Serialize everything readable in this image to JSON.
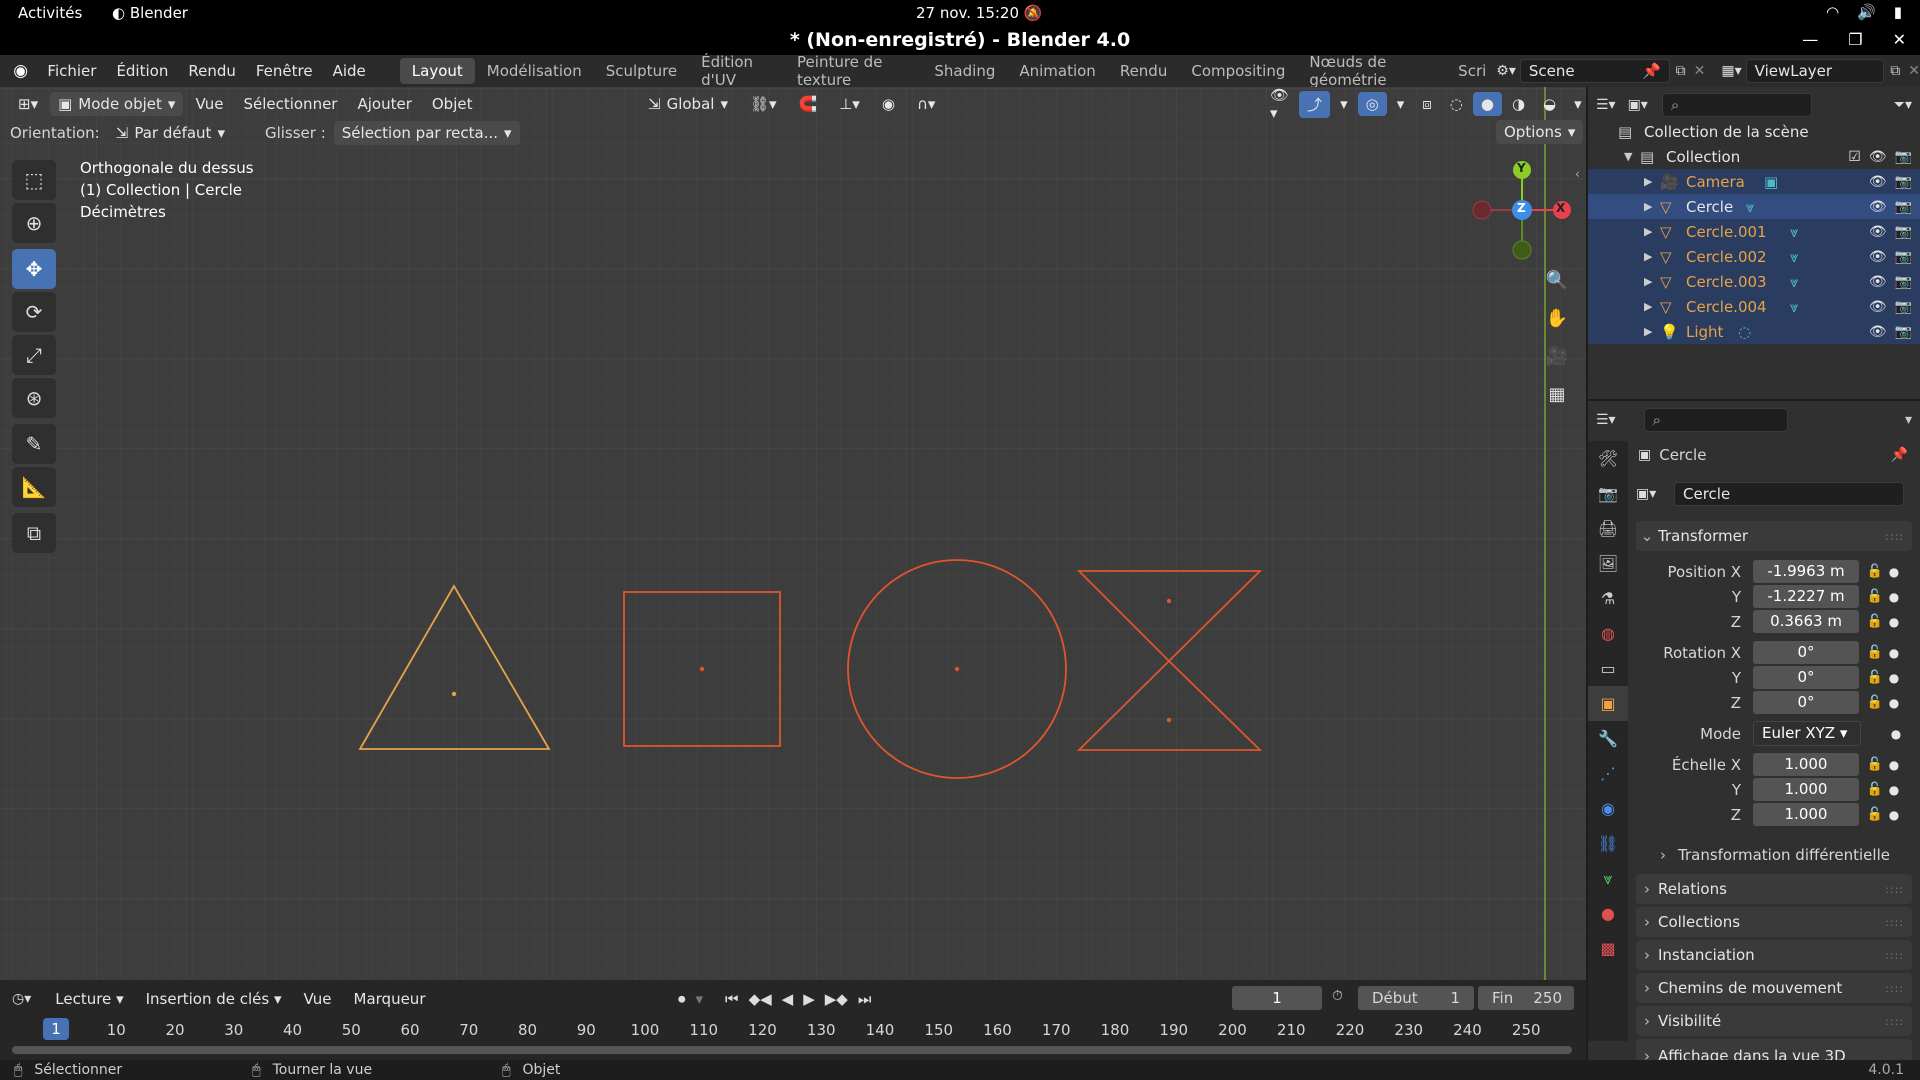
{
  "system": {
    "activities": "Activités",
    "app_name": "Blender",
    "clock": "27 nov.  15:20"
  },
  "window": {
    "title": "* (Non-enregistré) - Blender 4.0"
  },
  "menu": [
    "Fichier",
    "Édition",
    "Rendu",
    "Fenêtre",
    "Aide"
  ],
  "workspaces": [
    "Layout",
    "Modélisation",
    "Sculpture",
    "Édition d'UV",
    "Peinture de texture",
    "Shading",
    "Animation",
    "Rendu",
    "Compositing",
    "Nœuds de géométrie",
    "Scri"
  ],
  "scene": {
    "name": "Scene",
    "view_layer": "ViewLayer"
  },
  "viewport": {
    "header": {
      "mode": "Mode objet",
      "menus": [
        "Vue",
        "Sélectionner",
        "Ajouter",
        "Objet"
      ],
      "transform": "Global",
      "orientation_label": "Orientation:",
      "orientation_value": "Par défaut",
      "drag_label": "Glisser :",
      "drag_value": "Sélection par recta...",
      "options": "Options"
    },
    "overlay_lines": [
      "Orthogonale du dessus",
      "(1) Collection | Cercle",
      "Décimètres"
    ],
    "gizmo": {
      "x": "X",
      "y": "Y",
      "z": "Z"
    }
  },
  "outliner": {
    "scene_collection": "Collection de la scène",
    "collection": "Collection",
    "items": [
      "Camera",
      "Cercle",
      "Cercle.001",
      "Cercle.002",
      "Cercle.003",
      "Cercle.004",
      "Light"
    ]
  },
  "properties": {
    "object_name": "Cercle",
    "data_name": "Cercle",
    "transform_header": "Transformer",
    "location_label": "Position X",
    "location": [
      "-1.9963 m",
      "-1.2227 m",
      "0.3663 m"
    ],
    "rotation_label": "Rotation X",
    "rotation": [
      "0°",
      "0°",
      "0°"
    ],
    "mode_label": "Mode",
    "mode_value": "Euler XYZ",
    "scale_label": "Échelle X",
    "scale": [
      "1.000",
      "1.000",
      "1.000"
    ],
    "axis_y": "Y",
    "axis_z": "Z",
    "delta": "Transformation différentielle",
    "panels": [
      "Relations",
      "Collections",
      "Instanciation",
      "Chemins de mouvement",
      "Visibilité",
      "Affichage dans la vue 3D"
    ]
  },
  "timeline": {
    "menus": [
      "Lecture",
      "Insertion de clés",
      "Vue",
      "Marqueur"
    ],
    "current_frame": "1",
    "start_label": "Début",
    "start": "1",
    "end_label": "Fin",
    "end": "250",
    "ticks": [
      "1",
      "10",
      "20",
      "30",
      "40",
      "50",
      "60",
      "70",
      "80",
      "90",
      "100",
      "110",
      "120",
      "130",
      "140",
      "150",
      "160",
      "170",
      "180",
      "190",
      "200",
      "210",
      "220",
      "230",
      "240",
      "250"
    ]
  },
  "status": {
    "select": "Sélectionner",
    "rotate": "Tourner la vue",
    "object": "Objet",
    "version": "4.0.1"
  },
  "colors": {
    "accent": "#4772b3",
    "selected_orange": "#e6a34a",
    "object_orange": "#e0552b",
    "axis_x": "#e8404d",
    "axis_y": "#8ccc26",
    "axis_z": "#3d8ee8"
  }
}
